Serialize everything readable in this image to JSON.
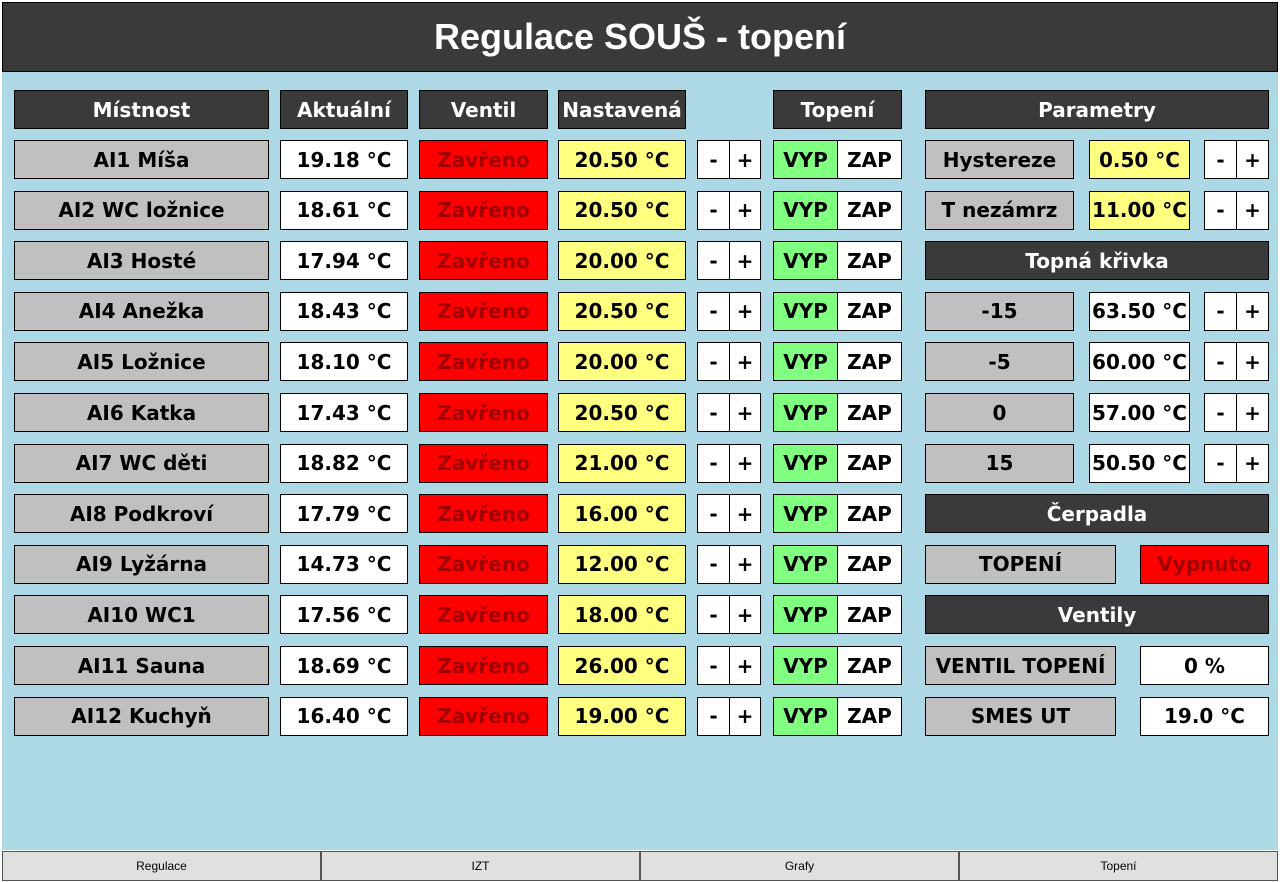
{
  "title": "Regulace SOUŠ - topení",
  "headers": {
    "room": "Místnost",
    "actual": "Aktuální",
    "valve": "Ventil",
    "set": "Nastavená",
    "heating": "Topení",
    "params": "Parametry"
  },
  "labels": {
    "minus": "-",
    "plus": "+",
    "off": "VYP",
    "on": "ZAP"
  },
  "rooms": [
    {
      "name": "AI1 Míša",
      "actual": "19.18 °C",
      "valve": "Zavřeno",
      "set": "20.50 °C"
    },
    {
      "name": "AI2 WC ložnice",
      "actual": "18.61 °C",
      "valve": "Zavřeno",
      "set": "20.50 °C"
    },
    {
      "name": "AI3 Hosté",
      "actual": "17.94 °C",
      "valve": "Zavřeno",
      "set": "20.00 °C"
    },
    {
      "name": "AI4 Anežka",
      "actual": "18.43 °C",
      "valve": "Zavřeno",
      "set": "20.50 °C"
    },
    {
      "name": "AI5 Ložnice",
      "actual": "18.10 °C",
      "valve": "Zavřeno",
      "set": "20.00 °C"
    },
    {
      "name": "AI6 Katka",
      "actual": "17.43 °C",
      "valve": "Zavřeno",
      "set": "20.50 °C"
    },
    {
      "name": "AI7 WC děti",
      "actual": "18.82 °C",
      "valve": "Zavřeno",
      "set": "21.00 °C"
    },
    {
      "name": "AI8 Podkroví",
      "actual": "17.79 °C",
      "valve": "Zavřeno",
      "set": "16.00 °C"
    },
    {
      "name": "AI9 Lyžárna",
      "actual": "14.73 °C",
      "valve": "Zavřeno",
      "set": "12.00 °C"
    },
    {
      "name": "AI10 WC1",
      "actual": "17.56 °C",
      "valve": "Zavřeno",
      "set": "18.00 °C"
    },
    {
      "name": "AI11 Sauna",
      "actual": "18.69 °C",
      "valve": "Zavřeno",
      "set": "26.00 °C"
    },
    {
      "name": "AI12 Kuchyň",
      "actual": "16.40 °C",
      "valve": "Zavřeno",
      "set": "19.00 °C"
    }
  ],
  "params": [
    {
      "label": "Hystereze",
      "value": "0.50 °C"
    },
    {
      "label": "T nezámrz",
      "value": "11.00 °C"
    }
  ],
  "curve_title": "Topná křivka",
  "curve": [
    {
      "label": "-15",
      "value": "63.50 °C"
    },
    {
      "label": "-5",
      "value": "60.00 °C"
    },
    {
      "label": "0",
      "value": "57.00 °C"
    },
    {
      "label": "15",
      "value": "50.50 °C"
    }
  ],
  "pumps_title": "Čerpadla",
  "pump": {
    "label": "TOPENÍ",
    "status": "Vypnuto"
  },
  "valves_title": "Ventily",
  "valves": [
    {
      "label": "VENTIL TOPENÍ",
      "value": "0 %"
    },
    {
      "label": "SMES UT",
      "value": "19.0 °C"
    }
  ],
  "tabs": [
    "Regulace",
    "IZT",
    "Grafy",
    "Topení"
  ],
  "colors": {
    "valve_closed": "#ff0000",
    "set_bg": "#ffff80",
    "off_active": "#80ff80",
    "header_bg": "#3a3a3a",
    "background": "#add8e6"
  }
}
